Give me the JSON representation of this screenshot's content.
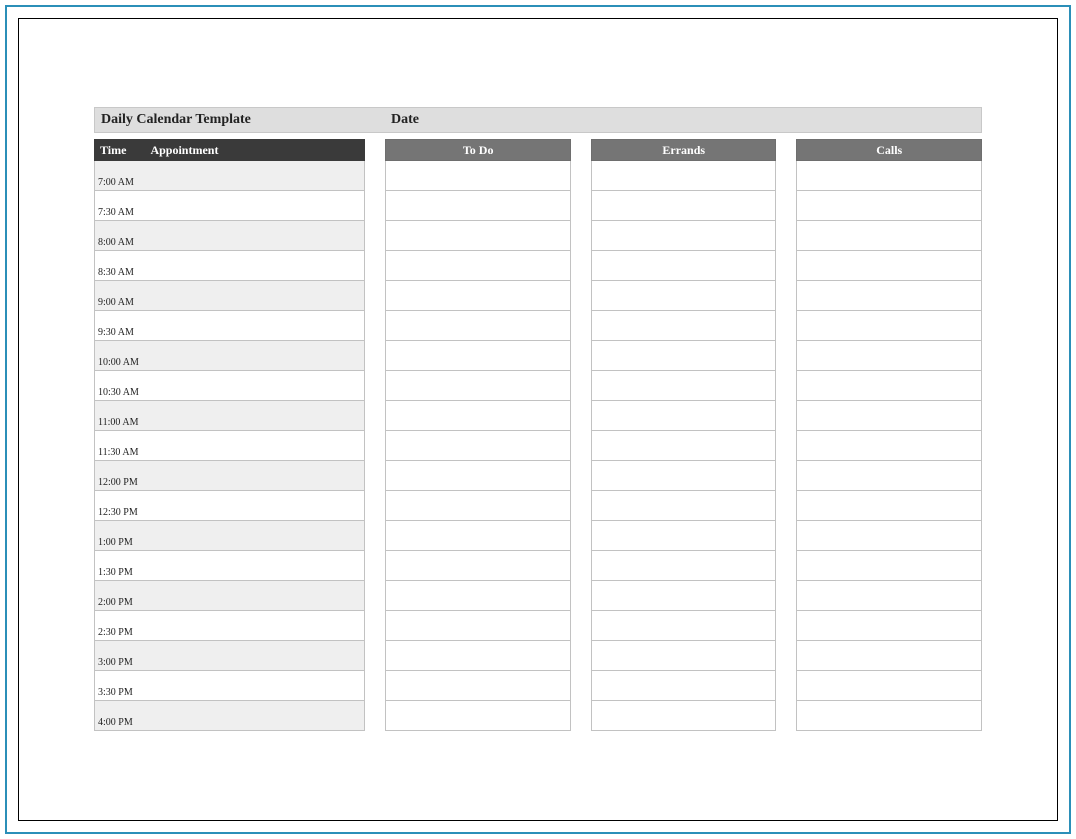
{
  "title": "Daily Calendar Template",
  "date_label": "Date",
  "headers": {
    "time": "Time",
    "appointment": "Appointment",
    "todo": "To Do",
    "errands": "Errands",
    "calls": "Calls"
  },
  "time_slots": [
    "7:00 AM",
    "7:30 AM",
    "8:00 AM",
    "8:30 AM",
    "9:00 AM",
    "9:30 AM",
    "10:00 AM",
    "10:30 AM",
    "11:00 AM",
    "11:30 AM",
    "12:00 PM",
    "12:30 PM",
    "1:00 PM",
    "1:30 PM",
    "2:00 PM",
    "2:30 PM",
    "3:00 PM",
    "3:30 PM",
    "4:00 PM"
  ],
  "list_row_count": 19
}
